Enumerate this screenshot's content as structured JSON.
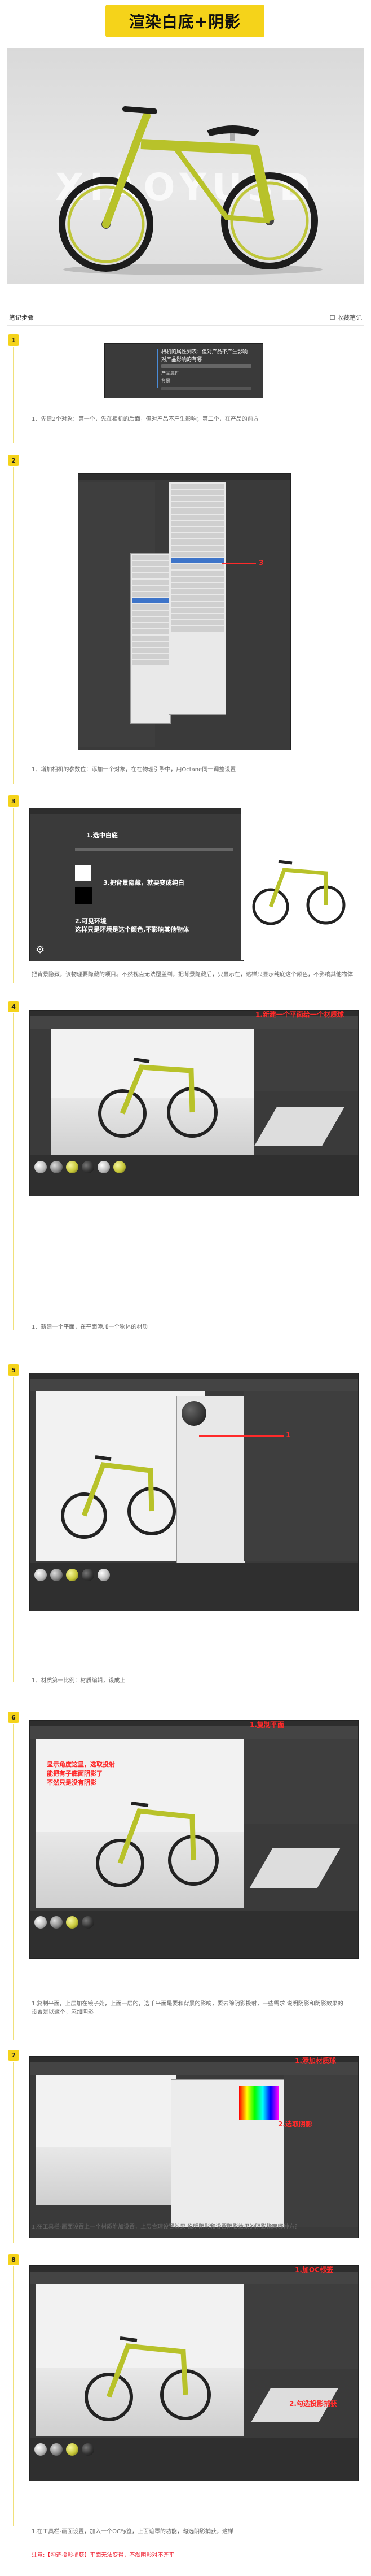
{
  "title": "渲染白底+阴影",
  "hero": {
    "watermark": "XIAOYU3D"
  },
  "notes_header": {
    "left": "笔记步骤",
    "right": "收藏笔记"
  },
  "steps": [
    {
      "num": "1",
      "menu": {
        "title": "相机的属性列表：但对产品不产生影响",
        "sub": "对产品影响的有哪",
        "items": [
          "产品属性",
          "背景"
        ]
      },
      "caption": "1、先建2个对象：第一个，先在相机的后面，但对产品不产生影响；第二个，在产品的前方"
    },
    {
      "num": "2",
      "label": "3",
      "caption": "1、增加相机的参数位：添加一个对象，在在物理引擎中，用Octane同一调整设置"
    },
    {
      "num": "3",
      "anno": {
        "a": "1.选中白底",
        "b": "3.把背景隐藏，就要变成纯白",
        "c": "2.可见环境\n这样只是环境是这个颜色,不影响其他物体"
      },
      "caption": "把背景隐藏，该物理要隐藏的项目。不然视点无法覆盖到，把背景隐藏后，只显示在，这样只显示纯底这个颜色，不影响其他物体"
    },
    {
      "num": "4",
      "anno": {
        "a": "1.新建一个平面给一个材质球"
      },
      "caption": "1、新建一个平面，在平面添加一个物体的材质"
    },
    {
      "num": "5",
      "anno": {
        "a": "1"
      },
      "caption": "1、材质第一比例：材质编辑，设成上"
    },
    {
      "num": "6",
      "anno": {
        "a": "1.复制平面",
        "b": "显示角度这里，选取投射\n能把有子底面阴影了\n不然只是没有阴影"
      },
      "caption": "1.复制平面，上层加在镜子处，上面一层的，选千平面是要和背景的影响，要去除阴影投射，一些需求\n说明阴影和阴影效果的设置是以这个，添加阴影"
    },
    {
      "num": "7",
      "anno": {
        "a": "1.添加材质球",
        "b": "2.选取阴影"
      },
      "caption": "1.在工具栏-画面设置上一个材质附加设置，上层合理设置效果\n说明阴影和设置阴影效果的阴影指南哪种方？"
    },
    {
      "num": "8",
      "anno": {
        "a": "1.加OC标签",
        "b": "2.勾选投影捕获"
      },
      "caption": "1.在工具栏-画面设置，加入一个OC标签，上面遮罩的功能，勾选阴影捕获，这样",
      "note": "注意:【勾选投影捕获】平面无法变得，不然阴影对不齐平"
    }
  ],
  "colors": {
    "accent": "#f5d31a",
    "bike": "#b8c22a",
    "annotation": "#ff2a2a"
  }
}
